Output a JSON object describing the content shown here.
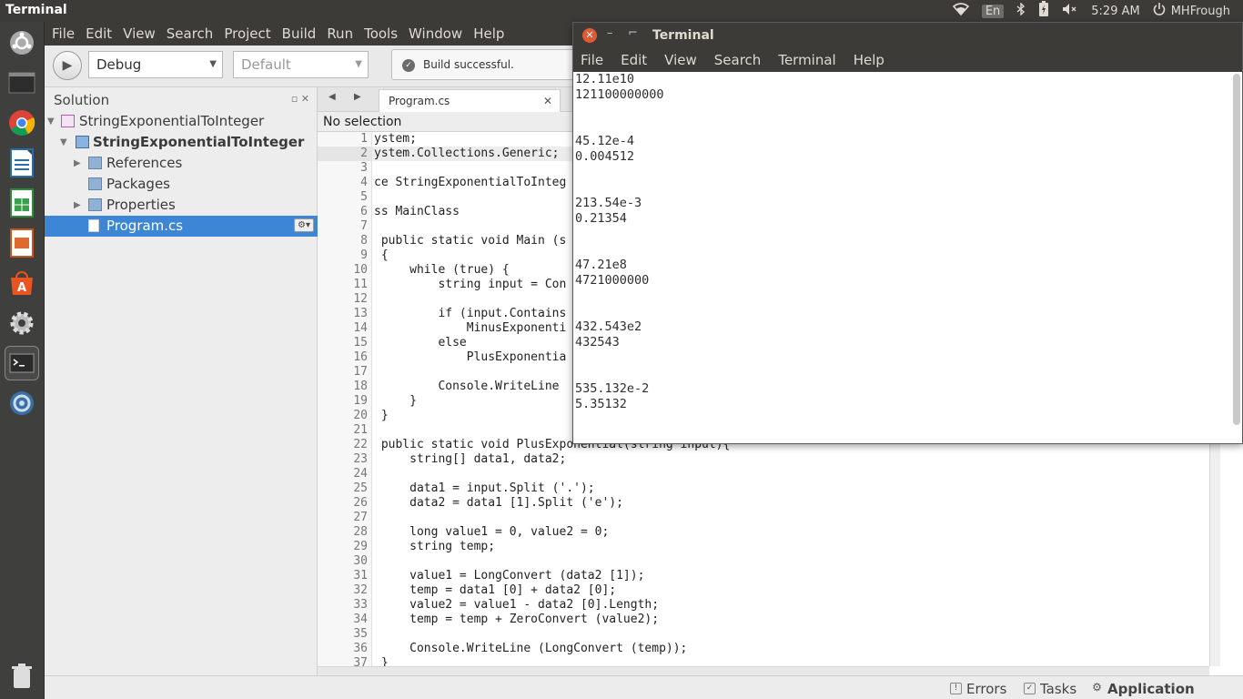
{
  "top_panel": {
    "app_title": "Terminal",
    "keyboard_layout": "En",
    "clock": "5:29 AM",
    "user": "MHFrough"
  },
  "ide": {
    "menu": [
      "File",
      "Edit",
      "View",
      "Search",
      "Project",
      "Build",
      "Run",
      "Tools",
      "Window",
      "Help"
    ],
    "toolbar": {
      "config": "Debug",
      "platform": "Default",
      "status": "Build successful."
    },
    "solution_pad": {
      "title": "Solution",
      "tree": [
        {
          "label": "StringExponentialToInteger",
          "kind": "solution"
        },
        {
          "label": "StringExponentialToInteger",
          "kind": "project"
        },
        {
          "label": "References",
          "kind": "folder"
        },
        {
          "label": "Packages",
          "kind": "folder"
        },
        {
          "label": "Properties",
          "kind": "folder"
        },
        {
          "label": "Program.cs",
          "kind": "file",
          "selected": true
        }
      ]
    },
    "editor": {
      "tab": "Program.cs",
      "path_bar": "No selection",
      "current_line": 2,
      "lines": [
        {
          "n": "1",
          "text": "ystem;"
        },
        {
          "n": "2",
          "text": "ystem.Collections.Generic;"
        },
        {
          "n": "3",
          "text": ""
        },
        {
          "n": "4",
          "text": "ce StringExponentialToInteg"
        },
        {
          "n": "5",
          "text": ""
        },
        {
          "n": "6",
          "text": "ss MainClass"
        },
        {
          "n": "7",
          "text": ""
        },
        {
          "n": "8",
          "text": " public static void Main (s"
        },
        {
          "n": "9",
          "text": " {"
        },
        {
          "n": "10",
          "text": "     while (true) {"
        },
        {
          "n": "11",
          "text": "         string input = Con"
        },
        {
          "n": "12",
          "text": ""
        },
        {
          "n": "13",
          "text": "         if (input.Contains"
        },
        {
          "n": "14",
          "text": "             MinusExponenti"
        },
        {
          "n": "15",
          "text": "         else"
        },
        {
          "n": "16",
          "text": "             PlusExponentia"
        },
        {
          "n": "17",
          "text": ""
        },
        {
          "n": "18",
          "text": "         Console.WriteLine"
        },
        {
          "n": "19",
          "text": "     }"
        },
        {
          "n": "20",
          "text": " }"
        },
        {
          "n": "21",
          "text": ""
        },
        {
          "n": "22",
          "text": " public static void PlusExponential(string input){"
        },
        {
          "n": "23",
          "text": "     string[] data1, data2;"
        },
        {
          "n": "24",
          "text": ""
        },
        {
          "n": "25",
          "text": "     data1 = input.Split ('.');"
        },
        {
          "n": "26",
          "text": "     data2 = data1 [1].Split ('e');"
        },
        {
          "n": "27",
          "text": ""
        },
        {
          "n": "28",
          "text": "     long value1 = 0, value2 = 0;"
        },
        {
          "n": "29",
          "text": "     string temp;"
        },
        {
          "n": "30",
          "text": ""
        },
        {
          "n": "31",
          "text": "     value1 = LongConvert (data2 [1]);"
        },
        {
          "n": "32",
          "text": "     temp = data1 [0] + data2 [0];"
        },
        {
          "n": "33",
          "text": "     value2 = value1 - data2 [0].Length;"
        },
        {
          "n": "34",
          "text": "     temp = temp + ZeroConvert (value2);"
        },
        {
          "n": "35",
          "text": ""
        },
        {
          "n": "36",
          "text": "     Console.WriteLine (LongConvert (temp));"
        },
        {
          "n": "37",
          "text": " }"
        }
      ]
    },
    "bottom_pads": [
      "Errors",
      "Tasks",
      "Application Output"
    ]
  },
  "terminal": {
    "title": "Terminal",
    "menu": [
      "File",
      "Edit",
      "View",
      "Search",
      "Terminal",
      "Help"
    ],
    "output": [
      "12.11e10",
      "121100000000",
      "",
      "",
      "45.12e-4",
      "0.004512",
      "",
      "",
      "213.54e-3",
      "0.21354",
      "",
      "",
      "47.21e8",
      "4721000000",
      "",
      "",
      "432.543e2",
      "432543",
      "",
      "",
      "535.132e-2",
      "5.35132"
    ]
  },
  "colors": {
    "panel": "#3c3b37",
    "selection": "#3d86d6",
    "close_button": "#e05b35"
  }
}
